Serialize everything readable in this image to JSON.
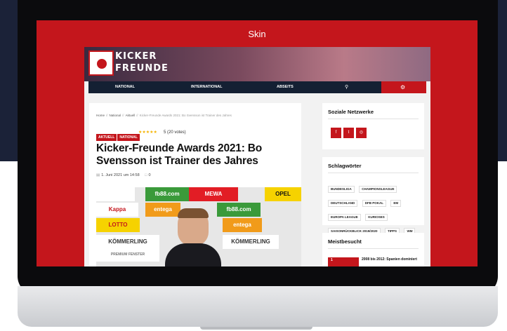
{
  "screen": {
    "skin_label": "Skin"
  },
  "site": {
    "logo_line1": "KICKER",
    "logo_line2": "FREUNDE",
    "nav": {
      "items": [
        "NATIONAL",
        "INTERNATIONAL",
        "ABSEITS"
      ],
      "search_icon": "search-icon",
      "settings_icon": "gear-icon"
    },
    "article": {
      "breadcrumb": [
        "Home",
        "National",
        "Aktuell",
        "Kicker-Freunde Awards 2021: Bo Svensson ist Trainer des Jahres"
      ],
      "badges": [
        "AKTUELL",
        "NATIONAL"
      ],
      "stars": "★★★★★",
      "votes": "5 (20 votes)",
      "title": "Kicker-Freunde Awards 2021: Bo Svensson ist Trainer des Jahres",
      "date": "1. Juni 2021 um 14:58",
      "comments": "0",
      "ads": [
        "fb88.com",
        "MEWA",
        "OPEL",
        "Kappa",
        "entega",
        "fb88.com",
        "LOTTO",
        "entega",
        "KÖMMERLING",
        "KÖMMERLING",
        "PREMIUM FENSTER"
      ]
    },
    "sidebar": {
      "social": {
        "title": "Soziale Netzwerke",
        "icons": [
          "facebook-icon",
          "twitter-icon",
          "instagram-icon"
        ]
      },
      "tags": {
        "title": "Schlagwörter",
        "items": [
          "BUNDESLIGA",
          "CHAMPIONSLEAGUE",
          "DEUTSCHLAND",
          "DFB POKAL",
          "EM",
          "EUROPA LEAGUE",
          "KURIOSES",
          "SAISONRÜCKBLICK 2019/2020",
          "TIPPS",
          "WM"
        ]
      },
      "most_visited": {
        "title": "Meistbesucht",
        "first_num": "1",
        "first_title": "2008 bis 2012: Spanien dominiert"
      }
    },
    "colors": {
      "brand_red": "#c4161c",
      "nav_bg": "#142033",
      "star": "#f5b301"
    }
  }
}
